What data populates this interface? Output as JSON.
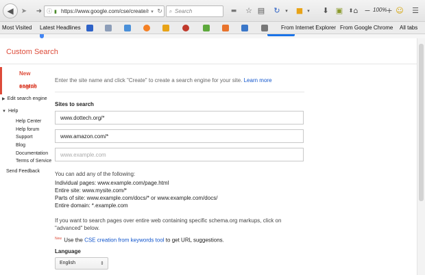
{
  "browser": {
    "url": "https://www.google.com/cse/create/ne",
    "search_placeholder": "Search",
    "zoom": "100%",
    "zoom_minus": "−",
    "zoom_plus": "+"
  },
  "bookmarks": {
    "most_visited": "Most Visited",
    "latest_headlines": "Latest Headlines",
    "from_ie": "From Internet Explorer",
    "from_chrome": "From Google Chrome",
    "all_tabs": "All tabs",
    "favicon_colors": [
      "#2e62c8",
      "#8c9db8",
      "#4a90d9",
      "#f48024",
      "#e8a317",
      "#c0392b",
      "#5da93c",
      "#e8732c",
      "#3a77c9",
      "#666"
    ]
  },
  "page": {
    "title": "Custom Search",
    "sidenav": {
      "active_line1": "New search",
      "active_line2": "engine",
      "edit": "Edit search engine",
      "help": "Help",
      "help_center": "Help Center",
      "help_forum": "Help forum",
      "support": "Support",
      "blog": "Blog",
      "documentation": "Documentation",
      "terms": "Terms of Service",
      "feedback": "Send Feedback"
    },
    "intro_text": "Enter the site name and click \"Create\" to create a search engine for your site.",
    "learn_more": "Learn more",
    "sites_heading": "Sites to search",
    "site1": "www.dottech.org/*",
    "site2": "www.amazon.com/*",
    "site3_placeholder": "www.example.com",
    "add_any": "You can add any of the following:",
    "individual": "Individual pages: www.example.com/page.html",
    "entire_site": "Entire site: www.mysite.com/*",
    "parts": "Parts of site: www.example.com/docs/* or www.example.com/docs/",
    "domain": "Entire domain: *.example.com",
    "schema1": "If you want to search pages over entire web containing specific schema.org markups, click on",
    "schema2": "\"advanced\" below.",
    "new_badge": "New",
    "use_the": "Use the",
    "keywords_tool": "CSE creation from keywords tool",
    "to_get": "to get URL suggestions.",
    "language_heading": "Language",
    "language_value": "English"
  }
}
